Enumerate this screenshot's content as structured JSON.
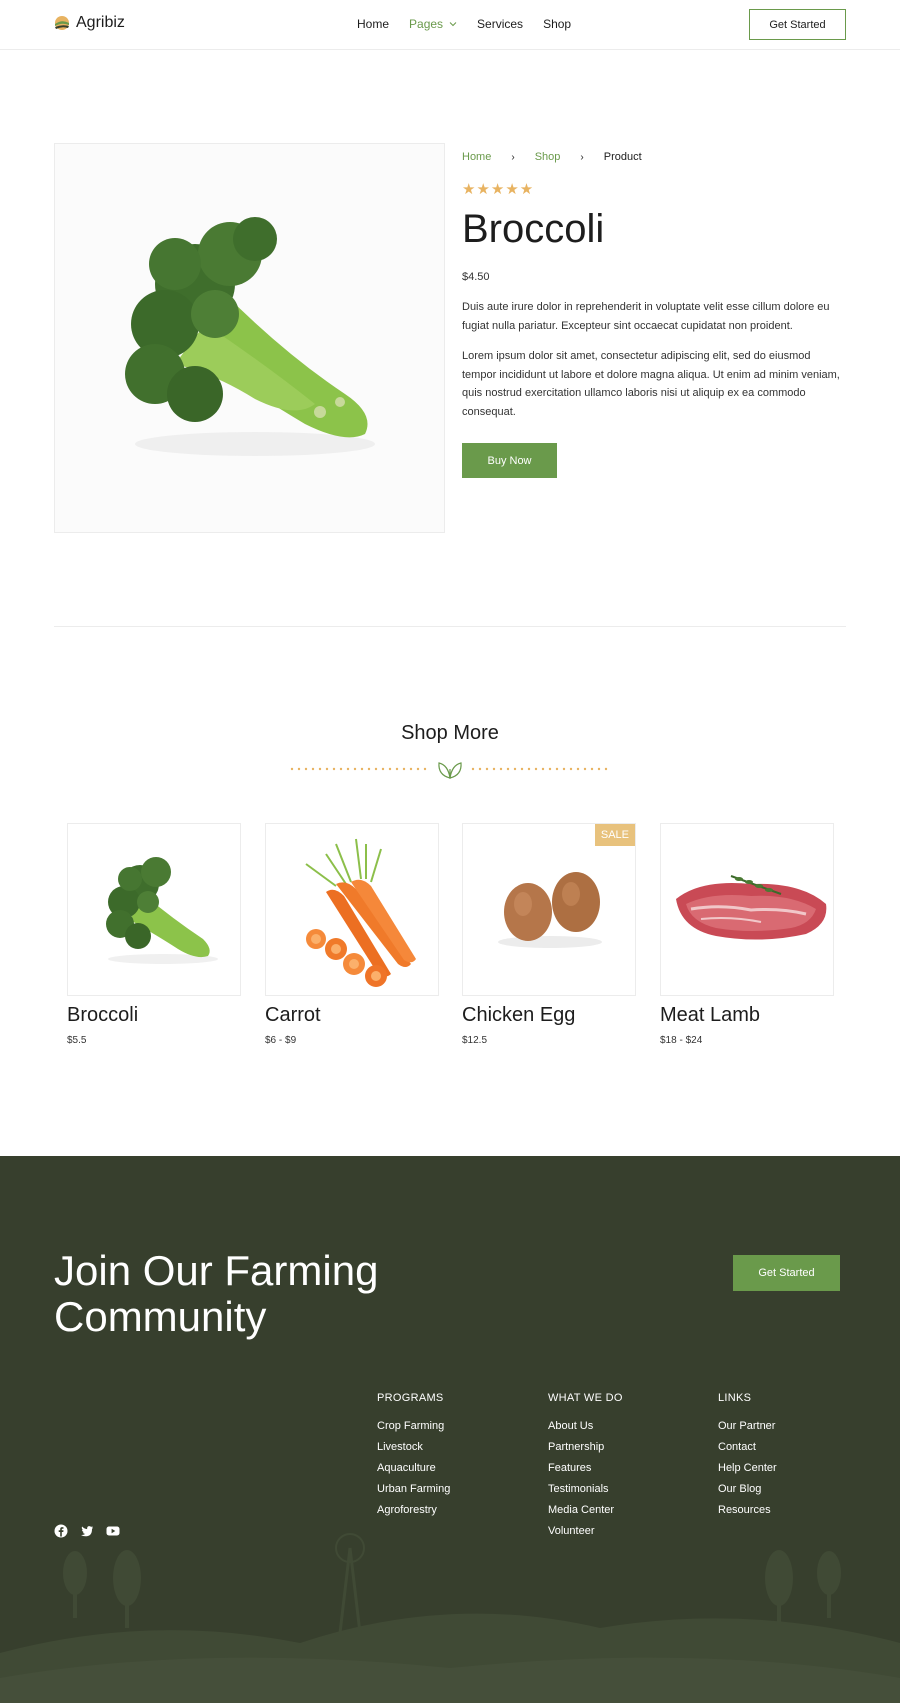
{
  "header": {
    "logo_text": "Agribiz",
    "nav": [
      {
        "label": "Home",
        "active": false
      },
      {
        "label": "Pages",
        "active": true,
        "has_dropdown": true
      },
      {
        "label": "Services",
        "active": false
      },
      {
        "label": "Shop",
        "active": false
      }
    ],
    "cta_label": "Get Started"
  },
  "product": {
    "breadcrumb": [
      "Home",
      "Shop",
      "Product"
    ],
    "rating": 5,
    "stars": "★★★★★",
    "title": "Broccoli",
    "price": "$4.50",
    "description_1": "Duis aute irure dolor in reprehenderit in voluptate velit esse cillum dolore eu fugiat nulla pariatur. Excepteur sint occaecat cupidatat non proident.",
    "description_2": "Lorem ipsum dolor sit amet, consectetur adipiscing elit, sed do eiusmod tempor incididunt ut labore et dolore magna aliqua. Ut enim ad minim veniam, quis nostrud exercitation ullamco laboris nisi ut aliquip ex ea commodo consequat.",
    "buy_label": "Buy Now"
  },
  "shop_more": {
    "title": "Shop More",
    "items": [
      {
        "name": "Broccoli",
        "price": "$5.5",
        "badge": ""
      },
      {
        "name": "Carrot",
        "price": "$6 - $9",
        "badge": ""
      },
      {
        "name": "Chicken Egg",
        "price": "$12.5",
        "badge": "SALE"
      },
      {
        "name": "Meat Lamb",
        "price": "$18 - $24",
        "badge": ""
      }
    ]
  },
  "footer": {
    "title": "Join Our Farming Community",
    "cta_label": "Get Started",
    "columns": [
      {
        "heading": "PROGRAMS",
        "links": [
          "Crop Farming",
          "Livestock",
          "Aquaculture",
          "Urban Farming",
          "Agroforestry"
        ]
      },
      {
        "heading": "WHAT WE DO",
        "links": [
          "About Us",
          "Partnership",
          "Features",
          "Testimonials",
          "Media Center",
          "Volunteer"
        ]
      },
      {
        "heading": "LINKS",
        "links": [
          "Our Partner",
          "Contact",
          "Help Center",
          "Our Blog",
          "Resources"
        ]
      }
    ],
    "socials": [
      "facebook-icon",
      "twitter-icon",
      "youtube-icon"
    ]
  },
  "colors": {
    "brand_green": "#6a9a4b",
    "star_gold": "#e8b361",
    "footer_bg": "#373f2d",
    "sale_badge": "#e8c27d"
  }
}
